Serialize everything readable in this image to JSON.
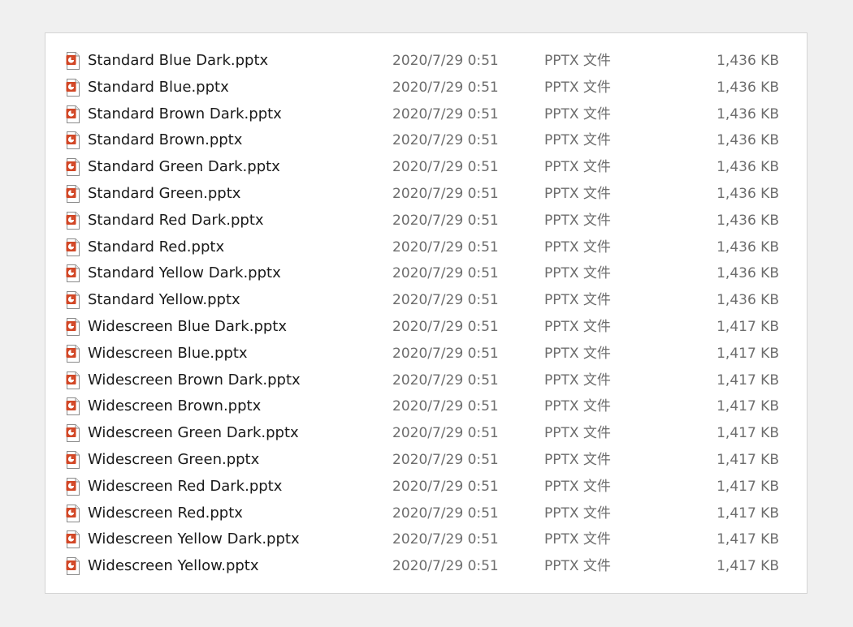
{
  "files": [
    {
      "name": "Standard Blue Dark.pptx",
      "date": "2020/7/29 0:51",
      "type": "PPTX 文件",
      "size": "1,436 KB",
      "icon": "pptx-file-icon"
    },
    {
      "name": "Standard Blue.pptx",
      "date": "2020/7/29 0:51",
      "type": "PPTX 文件",
      "size": "1,436 KB",
      "icon": "pptx-file-icon"
    },
    {
      "name": "Standard Brown Dark.pptx",
      "date": "2020/7/29 0:51",
      "type": "PPTX 文件",
      "size": "1,436 KB",
      "icon": "pptx-file-icon"
    },
    {
      "name": "Standard Brown.pptx",
      "date": "2020/7/29 0:51",
      "type": "PPTX 文件",
      "size": "1,436 KB",
      "icon": "pptx-file-icon"
    },
    {
      "name": "Standard Green Dark.pptx",
      "date": "2020/7/29 0:51",
      "type": "PPTX 文件",
      "size": "1,436 KB",
      "icon": "pptx-file-icon"
    },
    {
      "name": "Standard Green.pptx",
      "date": "2020/7/29 0:51",
      "type": "PPTX 文件",
      "size": "1,436 KB",
      "icon": "pptx-file-icon"
    },
    {
      "name": "Standard Red Dark.pptx",
      "date": "2020/7/29 0:51",
      "type": "PPTX 文件",
      "size": "1,436 KB",
      "icon": "pptx-file-icon"
    },
    {
      "name": "Standard Red.pptx",
      "date": "2020/7/29 0:51",
      "type": "PPTX 文件",
      "size": "1,436 KB",
      "icon": "pptx-file-icon"
    },
    {
      "name": "Standard Yellow Dark.pptx",
      "date": "2020/7/29 0:51",
      "type": "PPTX 文件",
      "size": "1,436 KB",
      "icon": "pptx-file-icon"
    },
    {
      "name": "Standard Yellow.pptx",
      "date": "2020/7/29 0:51",
      "type": "PPTX 文件",
      "size": "1,436 KB",
      "icon": "pptx-file-icon"
    },
    {
      "name": "Widescreen Blue Dark.pptx",
      "date": "2020/7/29 0:51",
      "type": "PPTX 文件",
      "size": "1,417 KB",
      "icon": "pptx-file-icon"
    },
    {
      "name": "Widescreen Blue.pptx",
      "date": "2020/7/29 0:51",
      "type": "PPTX 文件",
      "size": "1,417 KB",
      "icon": "pptx-file-icon"
    },
    {
      "name": "Widescreen Brown Dark.pptx",
      "date": "2020/7/29 0:51",
      "type": "PPTX 文件",
      "size": "1,417 KB",
      "icon": "pptx-file-icon"
    },
    {
      "name": "Widescreen Brown.pptx",
      "date": "2020/7/29 0:51",
      "type": "PPTX 文件",
      "size": "1,417 KB",
      "icon": "pptx-file-icon"
    },
    {
      "name": "Widescreen Green Dark.pptx",
      "date": "2020/7/29 0:51",
      "type": "PPTX 文件",
      "size": "1,417 KB",
      "icon": "pptx-file-icon"
    },
    {
      "name": "Widescreen Green.pptx",
      "date": "2020/7/29 0:51",
      "type": "PPTX 文件",
      "size": "1,417 KB",
      "icon": "pptx-file-icon"
    },
    {
      "name": "Widescreen Red Dark.pptx",
      "date": "2020/7/29 0:51",
      "type": "PPTX 文件",
      "size": "1,417 KB",
      "icon": "pptx-file-icon"
    },
    {
      "name": "Widescreen Red.pptx",
      "date": "2020/7/29 0:51",
      "type": "PPTX 文件",
      "size": "1,417 KB",
      "icon": "pptx-file-icon"
    },
    {
      "name": "Widescreen Yellow Dark.pptx",
      "date": "2020/7/29 0:51",
      "type": "PPTX 文件",
      "size": "1,417 KB",
      "icon": "pptx-file-icon"
    },
    {
      "name": "Widescreen Yellow.pptx",
      "date": "2020/7/29 0:51",
      "type": "PPTX 文件",
      "size": "1,417 KB",
      "icon": "pptx-file-icon"
    }
  ],
  "colors": {
    "background": "#f0f0f0",
    "panel": "#ffffff",
    "name_text": "#1a1a1a",
    "detail_text": "#6d6d6d",
    "icon_accent": "#d24726"
  }
}
